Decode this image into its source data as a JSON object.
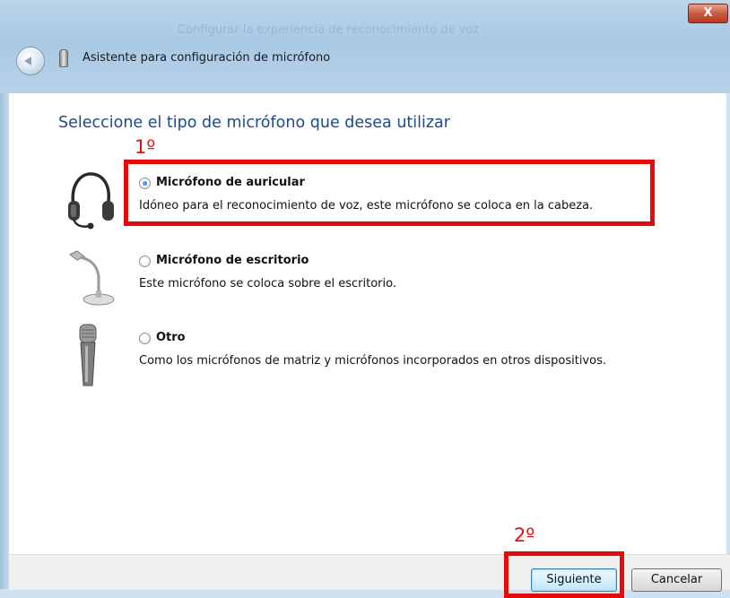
{
  "window": {
    "title": "Asistente para configuración de micrófono",
    "close_label": "X",
    "background_blur_texts": [
      "Configurar la experiencia de reconocimiento de voz"
    ]
  },
  "page": {
    "heading": "Seleccione el tipo de micrófono que desea utilizar"
  },
  "options": [
    {
      "label": "Micrófono de auricular",
      "description": "Idóneo para el reconocimiento de voz, este micrófono se coloca en la cabeza.",
      "selected": true,
      "icon": "headset-icon"
    },
    {
      "label": "Micrófono de escritorio",
      "description": "Este micrófono se coloca sobre el escritorio.",
      "selected": false,
      "icon": "desktop-microphone-icon"
    },
    {
      "label": "Otro",
      "description": "Como los micrófonos de matriz y micrófonos incorporados en otros dispositivos.",
      "selected": false,
      "icon": "handheld-microphone-icon"
    }
  ],
  "annotations": {
    "step1": "1º",
    "step2": "2º",
    "color": "#e50a0a"
  },
  "footer": {
    "next_label": "Siguiente",
    "cancel_label": "Cancelar"
  },
  "colors": {
    "heading": "#1e4a8a",
    "titlebar": "#b7d2e9"
  }
}
